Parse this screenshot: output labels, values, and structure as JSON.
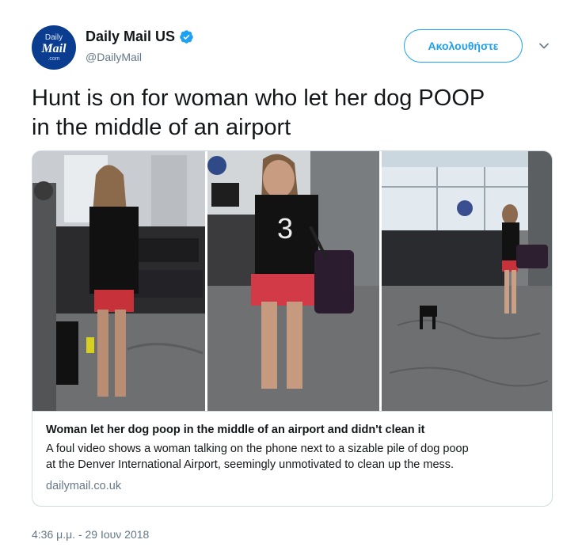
{
  "account": {
    "avatar_text": [
      "Daily",
      "Mail",
      ".com"
    ],
    "display_name": "Daily Mail US",
    "handle": "@DailyMail",
    "verified": true
  },
  "follow_button": {
    "label": "Ακολουθήστε"
  },
  "menu_icon": "chevron-down-icon",
  "tweet": {
    "text_line1": "Hunt is on for woman who let her dog POOP",
    "text_line2": "in the middle of an airport"
  },
  "card": {
    "images": [
      "airport-photo-1",
      "airport-photo-2",
      "airport-photo-3"
    ],
    "title": "Woman let her dog poop in the middle of an airport and didn't clean it",
    "description_line1": "A foul video shows a woman talking on the phone next to a sizable pile of dog poop",
    "description_line2": "at the Denver International Airport, seemingly unmotivated to clean up the mess.",
    "domain": "dailymail.co.uk"
  },
  "timestamp": "4:36 μ.μ. - 29 Ιουν 2018",
  "colors": {
    "accent": "#1da1f2",
    "text": "#14171a",
    "secondary_text": "#657786",
    "avatar_bg": "#0a3d8f"
  }
}
